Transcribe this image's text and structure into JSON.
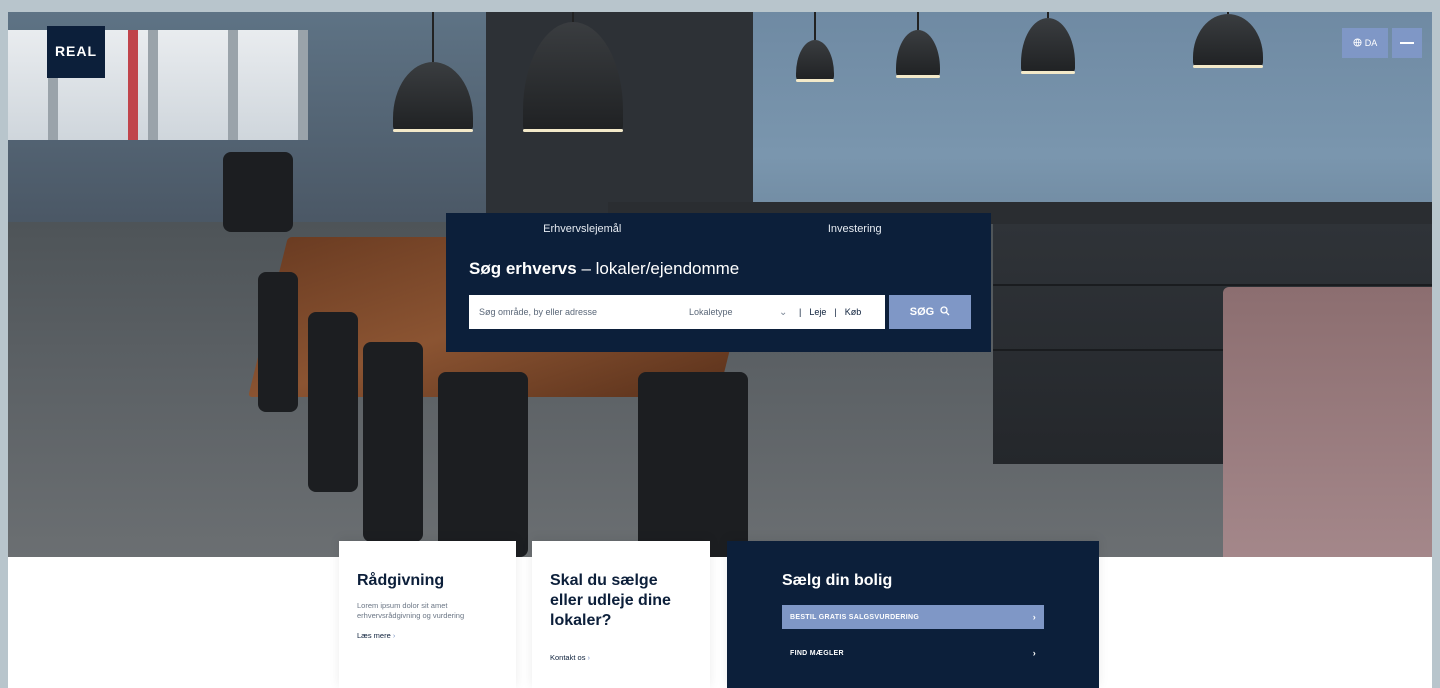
{
  "colors": {
    "navy": "#0c1f3a",
    "accent": "#7f97c6",
    "page_bg": "#b8c5cc"
  },
  "logo": {
    "word": "REAL",
    "sub": ""
  },
  "header": {
    "lang_label": "DA",
    "lang_icon": "globe-icon",
    "menu_icon": "hamburger-icon"
  },
  "search": {
    "tabs": [
      {
        "label": "Erhvervslejemål"
      },
      {
        "label": "Investering"
      }
    ],
    "heading_strong": "Søg erhvervs",
    "heading_rest": " – lokaler/ejendomme",
    "placeholder": "Søg område, by eller adresse",
    "type_label": "Lokaletype",
    "toggle_a": "Leje",
    "toggle_b": "Køb",
    "button_label": "SØG",
    "button_icon": "search-icon"
  },
  "cards": {
    "advice": {
      "title": "Rådgivning",
      "text": "Lorem ipsum dolor sit amet erhvervsrådgivning og vurdering",
      "link": "Læs mere"
    },
    "sell": {
      "title": "Skal du sælge eller udleje dine lokaler?",
      "link": "Kontakt os"
    },
    "home": {
      "title": "Sælg din bolig",
      "items": [
        {
          "label": "BESTIL GRATIS SALGSVURDERING",
          "active": true
        },
        {
          "label": "FIND MÆGLER",
          "active": false
        }
      ]
    }
  }
}
